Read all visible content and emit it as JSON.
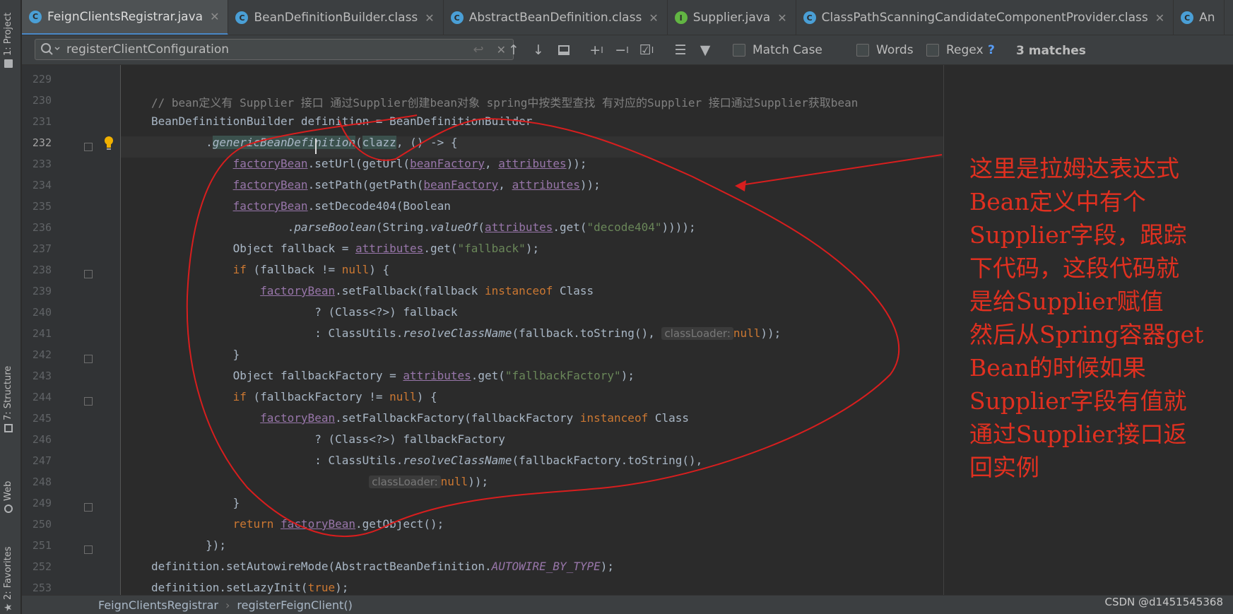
{
  "tabs": [
    {
      "label": "FeignClientsRegistrar.java",
      "icon": "C",
      "color": "#4a9fd6",
      "active": true
    },
    {
      "label": "BeanDefinitionBuilder.class",
      "icon": "C",
      "color": "#4a9fd6",
      "active": false
    },
    {
      "label": "AbstractBeanDefinition.class",
      "icon": "C",
      "color": "#4a9fd6",
      "active": false
    },
    {
      "label": "Supplier.java",
      "icon": "I",
      "color": "#62b543",
      "active": false
    },
    {
      "label": "ClassPathScanningCandidateComponentProvider.class",
      "icon": "C",
      "color": "#4a9fd6",
      "active": false
    },
    {
      "label": "An",
      "icon": "C",
      "color": "#4a9fd6",
      "active": false
    }
  ],
  "toolstrip": {
    "project": "1: Project",
    "structure": "7: Structure",
    "web": "Web",
    "favorites": "2: Favorites"
  },
  "find": {
    "query": "registerClientConfiguration",
    "match_case": "Match Case",
    "words": "Words",
    "regex": "Regex",
    "help": "?",
    "matches": "3 matches"
  },
  "code": {
    "line_numbers": [
      "229",
      "230",
      "231",
      "232",
      "233",
      "234",
      "235",
      "236",
      "237",
      "238",
      "239",
      "240",
      "241",
      "242",
      "243",
      "244",
      "245",
      "246",
      "247",
      "248",
      "249",
      "250",
      "251",
      "252",
      "253"
    ],
    "current_line": "232",
    "comment_230": "// bean定义有 Supplier 接口 通过Supplier创建bean对象 spring中按类型查找 有对应的Supplier 接口通过Supplier获取bean",
    "hint_classloader": "classLoader:"
  },
  "annotation": {
    "lines": [
      "这里是拉姆达表达式",
      "Bean定义中有个",
      "Supplier字段，跟踪",
      "下代码，这段代码就",
      "是给Supplier赋值",
      "然后从Spring容器get",
      "Bean的时候如果",
      "Supplier字段有值就",
      "通过Supplier接口返",
      "回实例"
    ]
  },
  "breadcrumb": {
    "class": "FeignClientsRegistrar",
    "sep": "›",
    "method": "registerFeignClient()"
  },
  "watermark": "CSDN @d1451545368",
  "colors": {
    "keyword": "#cc7832",
    "string": "#6a8759",
    "field": "#9876aa",
    "annotation": "#e03020",
    "accent": "#4a88c7"
  }
}
